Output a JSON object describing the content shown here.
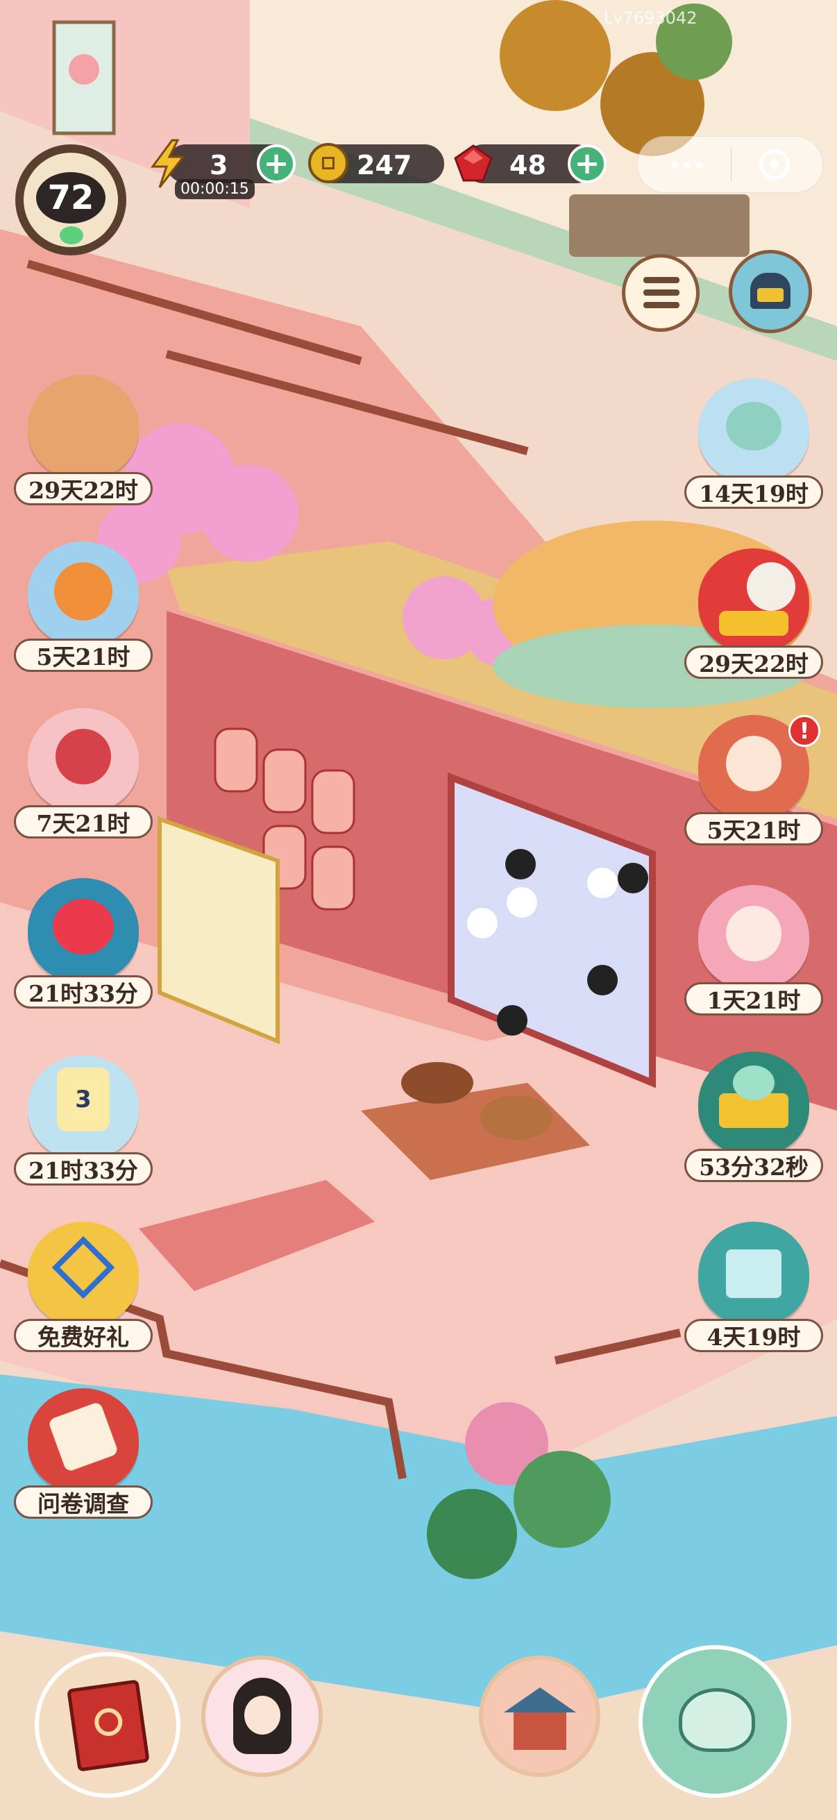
{
  "hud": {
    "level": "72",
    "energy": "3",
    "energy_timer": "00:00:15",
    "coins": "247",
    "gems": "48",
    "watermark": "Lv7693042"
  },
  "left_events": [
    {
      "name": "event-scroll-gift",
      "time": "29天22时"
    },
    {
      "name": "event-fox-hero",
      "time": "5天21时"
    },
    {
      "name": "event-red-fan",
      "time": "7天21时"
    },
    {
      "name": "event-flower-bloom",
      "time": "21时33分"
    },
    {
      "name": "event-lantern-count",
      "time": "21时33分",
      "count": "3"
    },
    {
      "name": "event-free-gift",
      "time": "免费好礼"
    },
    {
      "name": "event-survey",
      "time": "问卷调查"
    }
  ],
  "right_events": [
    {
      "name": "event-cloud-cat",
      "time": "14天19时"
    },
    {
      "name": "event-treasure-fan",
      "time": "29天22时"
    },
    {
      "name": "event-lucky-cat",
      "time": "5天21时",
      "alert": "!"
    },
    {
      "name": "event-pink-cat",
      "time": "1天21时"
    },
    {
      "name": "event-coin-cart",
      "time": "53分32秒"
    },
    {
      "name": "event-gift-box",
      "time": "4天19时"
    }
  ],
  "colors": {
    "hud_bg": "#2a1e1e",
    "plus_green": "#46b27a",
    "coin_gold": "#e8b524",
    "gem_red": "#d3262a",
    "label_border": "#7a5342"
  },
  "icons": {
    "task_list": "list-icon",
    "shop": "bell-icon",
    "journal": "book-icon",
    "character": "lady-portrait-icon",
    "house": "house-icon",
    "teapot": "teapot-icon"
  }
}
